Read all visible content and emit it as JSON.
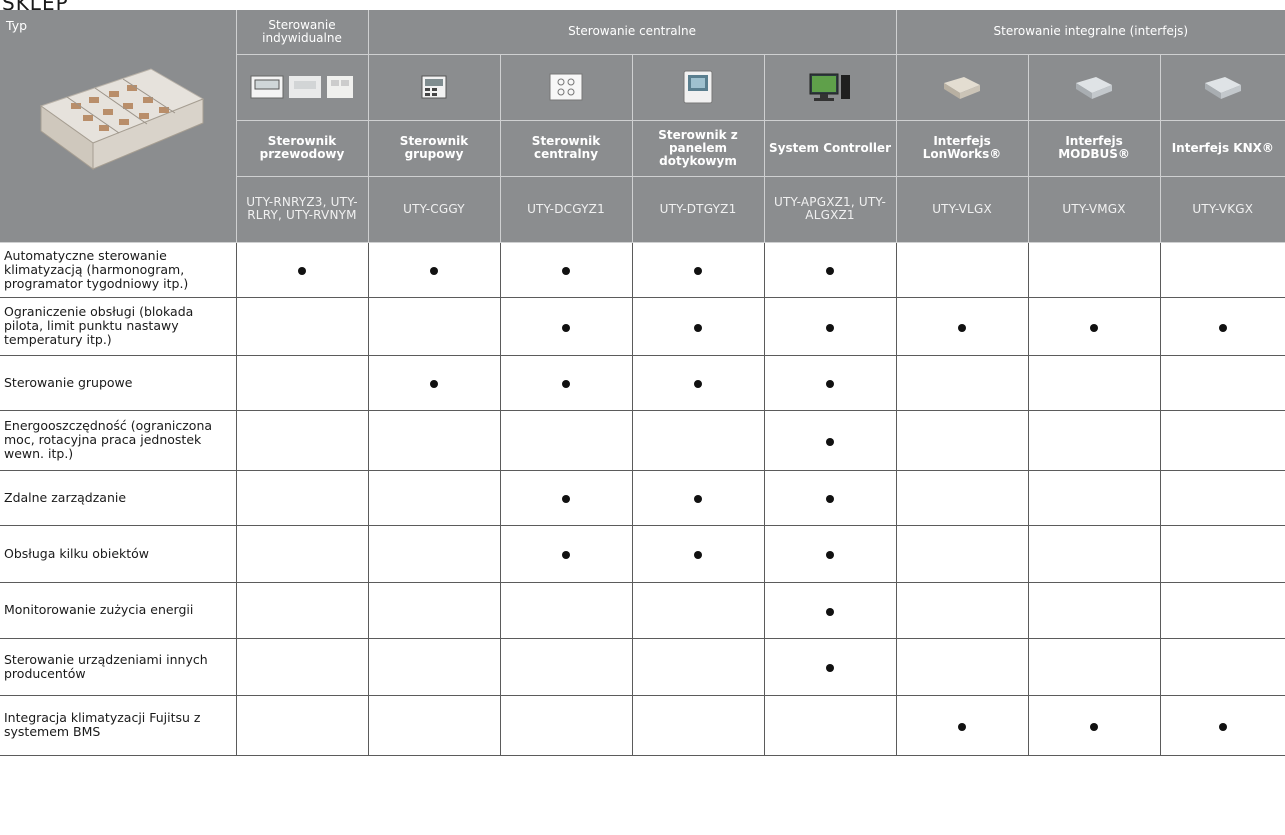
{
  "top_fragment": "SKLEP",
  "header": {
    "typ_label": "Typ",
    "groups": [
      {
        "label": "Sterowanie indywidualne"
      },
      {
        "label": "Sterowanie centralne"
      },
      {
        "label": "Sterowanie integralne (interfejs)"
      }
    ],
    "devices": [
      {
        "name": "Sterownik przewodowy",
        "model": "UTY-RNRYZ3, UTY-RLRY, UTY-RVNYM",
        "icon": "wired-remote-controllers-icon"
      },
      {
        "name": "Sterownik grupowy",
        "model": "UTY-CGGY",
        "icon": "group-controller-icon"
      },
      {
        "name": "Sterownik centralny",
        "model": "UTY-DCGYZ1",
        "icon": "central-controller-icon"
      },
      {
        "name": "Sterownik z panelem dotykowym",
        "model": "UTY-DTGYZ1",
        "icon": "touch-panel-controller-icon"
      },
      {
        "name": "System Controller",
        "model": "UTY-APGXZ1, UTY-ALGXZ1",
        "icon": "pc-system-controller-icon"
      },
      {
        "name": "Interfejs LonWorks®",
        "model": "UTY-VLGX",
        "icon": "interface-box-icon"
      },
      {
        "name": "Interfejs MODBUS®",
        "model": "UTY-VMGX",
        "icon": "interface-box-icon"
      },
      {
        "name": "Interfejs KNX®",
        "model": "UTY-VKGX",
        "icon": "interface-box-icon"
      }
    ]
  },
  "rows": [
    {
      "feature": "Automatyczne sterowanie klimatyzacją (harmonogram, programator tygodniowy itp.)",
      "marks": [
        1,
        1,
        1,
        1,
        1,
        0,
        0,
        0
      ]
    },
    {
      "feature": "Ograniczenie obsługi (blokada pilota, limit punktu nastawy temperatury itp.)",
      "marks": [
        0,
        0,
        1,
        1,
        1,
        1,
        1,
        1
      ]
    },
    {
      "feature": "Sterowanie grupowe",
      "marks": [
        0,
        1,
        1,
        1,
        1,
        0,
        0,
        0
      ]
    },
    {
      "feature": "Energooszczędność (ograniczona moc, rotacyjna praca jednostek wewn. itp.)",
      "marks": [
        0,
        0,
        0,
        0,
        1,
        0,
        0,
        0
      ]
    },
    {
      "feature": "Zdalne zarządzanie",
      "marks": [
        0,
        0,
        1,
        1,
        1,
        0,
        0,
        0
      ]
    },
    {
      "feature": "Obsługa kilku obiektów",
      "marks": [
        0,
        0,
        1,
        1,
        1,
        0,
        0,
        0
      ]
    },
    {
      "feature": "Monitorowanie zużycia energii",
      "marks": [
        0,
        0,
        0,
        0,
        1,
        0,
        0,
        0
      ]
    },
    {
      "feature": "Sterowanie urządzeniami innych producentów",
      "marks": [
        0,
        0,
        0,
        0,
        1,
        0,
        0,
        0
      ]
    },
    {
      "feature": "Integracja klimatyzacji Fujitsu z systemem BMS",
      "marks": [
        0,
        0,
        0,
        0,
        0,
        1,
        1,
        1
      ]
    }
  ],
  "colors": {
    "header_bg": "#8b8d8f",
    "dot": "#111111"
  }
}
